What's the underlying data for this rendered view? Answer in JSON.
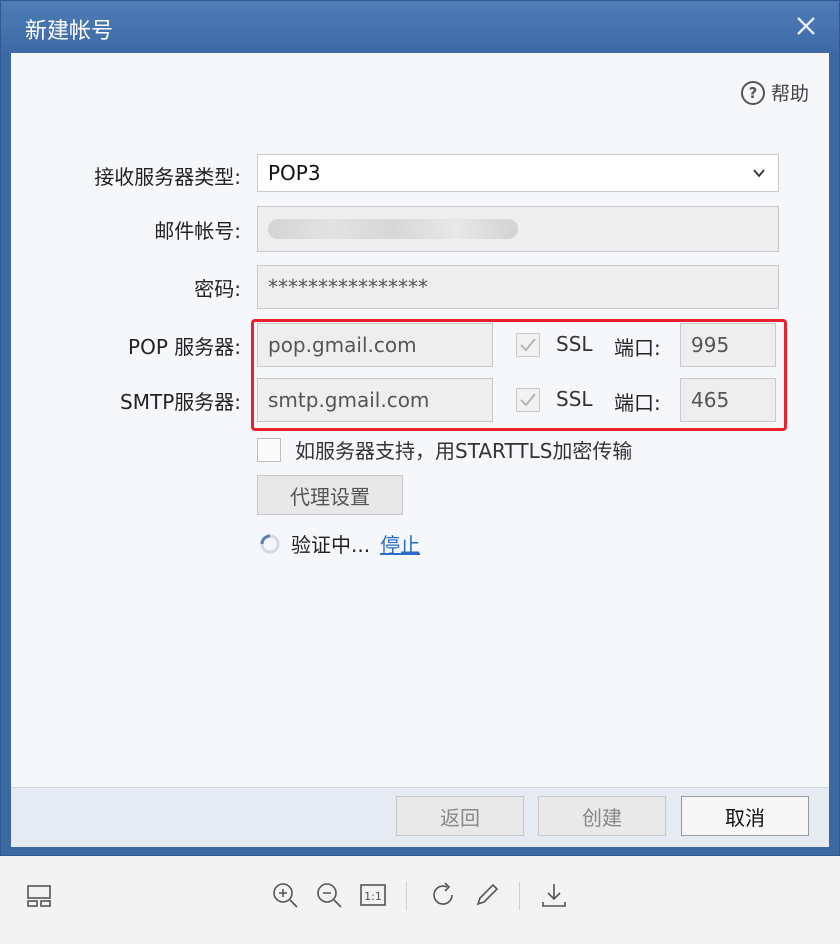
{
  "window": {
    "title": "新建帐号",
    "help_label": "帮助"
  },
  "form": {
    "server_type_label": "接收服务器类型:",
    "server_type_value": "POP3",
    "account_label": "邮件帐号:",
    "password_label": "密码:",
    "password_value": "****************",
    "pop_label": "POP 服务器:",
    "pop_server": "pop.gmail.com",
    "pop_ssl_label": "SSL",
    "pop_ssl_checked": true,
    "pop_port_label": "端口:",
    "pop_port": "995",
    "smtp_label": "SMTP服务器:",
    "smtp_server": "smtp.gmail.com",
    "smtp_ssl_label": "SSL",
    "smtp_ssl_checked": true,
    "smtp_port_label": "端口:",
    "smtp_port": "465",
    "starttls_label": "如服务器支持，用STARTTLS加密传输",
    "starttls_checked": false,
    "proxy_button": "代理设置",
    "verify_status": "验证中...",
    "stop_link": "停止"
  },
  "buttons": {
    "back": "返回",
    "create": "创建",
    "cancel": "取消"
  },
  "colors": {
    "titlebar": "#3d6aa6",
    "highlight": "#e8222a",
    "link": "#2b6cc4"
  },
  "viewer_toolbar": {
    "icons": [
      "thumbnail-layout-icon",
      "zoom-in-icon",
      "zoom-out-icon",
      "actual-size-icon",
      "rotate-icon",
      "edit-pen-icon",
      "download-icon"
    ],
    "actual_size_text": "1:1"
  }
}
